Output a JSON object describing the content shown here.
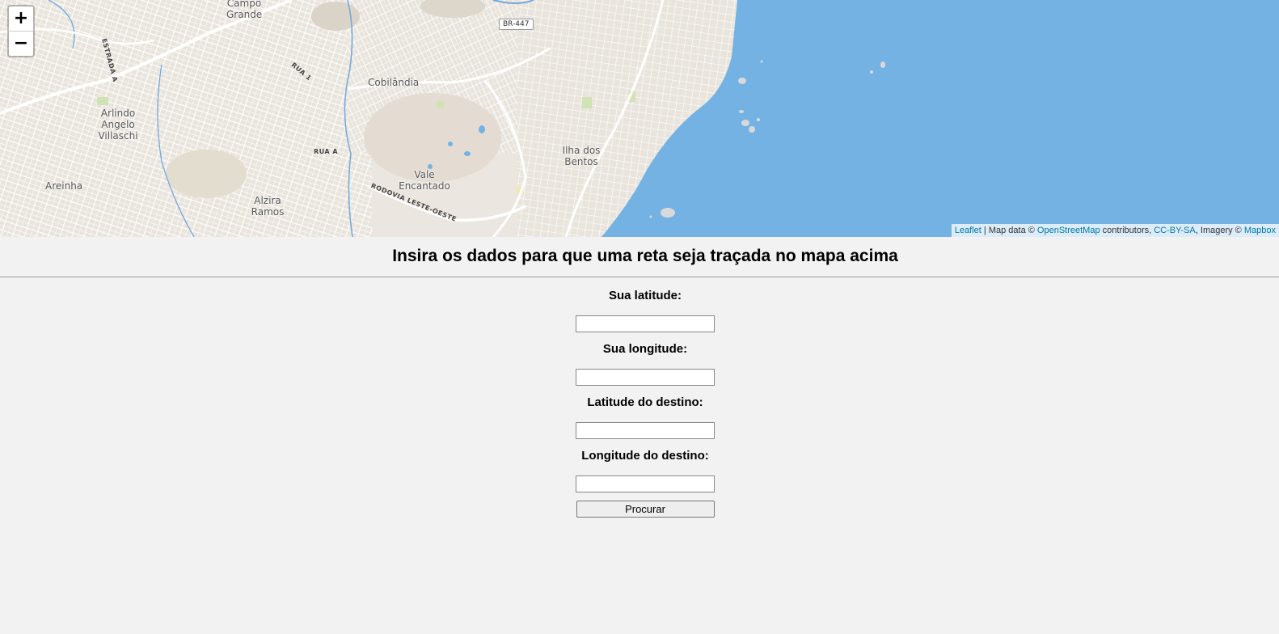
{
  "map": {
    "zoom_in_label": "+",
    "zoom_out_label": "−",
    "places": {
      "campo_grande": "Campo Grande",
      "arlindo": "Arlindo Angelo Villaschi",
      "areinha": "Areinha",
      "alzira": "Alzira Ramos",
      "cobilandia": "Cobilândia",
      "vale": "Vale Encantado",
      "ilha": "Ilha dos Bentos"
    },
    "roads": {
      "br447": "BR-447",
      "estrada": "ESTRADA A",
      "rua1": "RUA 1",
      "ruaa": "RUA A",
      "rodovia": "RODOVIA LESTE-OESTE"
    },
    "attribution": {
      "leaflet": "Leaflet",
      "sep": " | Map data © ",
      "osm": "OpenStreetMap",
      "contrib": " contributors, ",
      "license": "CC-BY-SA",
      "imagery": ", Imagery © ",
      "mapbox": "Mapbox"
    },
    "colors": {
      "water": "#73b2e3",
      "land": "#ebe6df",
      "road": "#ffffff",
      "river": "#6fa8dc",
      "park": "#cfe3b5"
    }
  },
  "page": {
    "heading": "Insira os dados para que uma reta seja traçada no mapa acima"
  },
  "form": {
    "lat_label": "Sua latitude:",
    "lat_value": "",
    "lng_label": "Sua longitude:",
    "lng_value": "",
    "dest_lat_label": "Latitude do destino:",
    "dest_lat_value": "",
    "dest_lng_label": "Longitude do destino:",
    "dest_lng_value": "",
    "submit_label": "Procurar"
  }
}
